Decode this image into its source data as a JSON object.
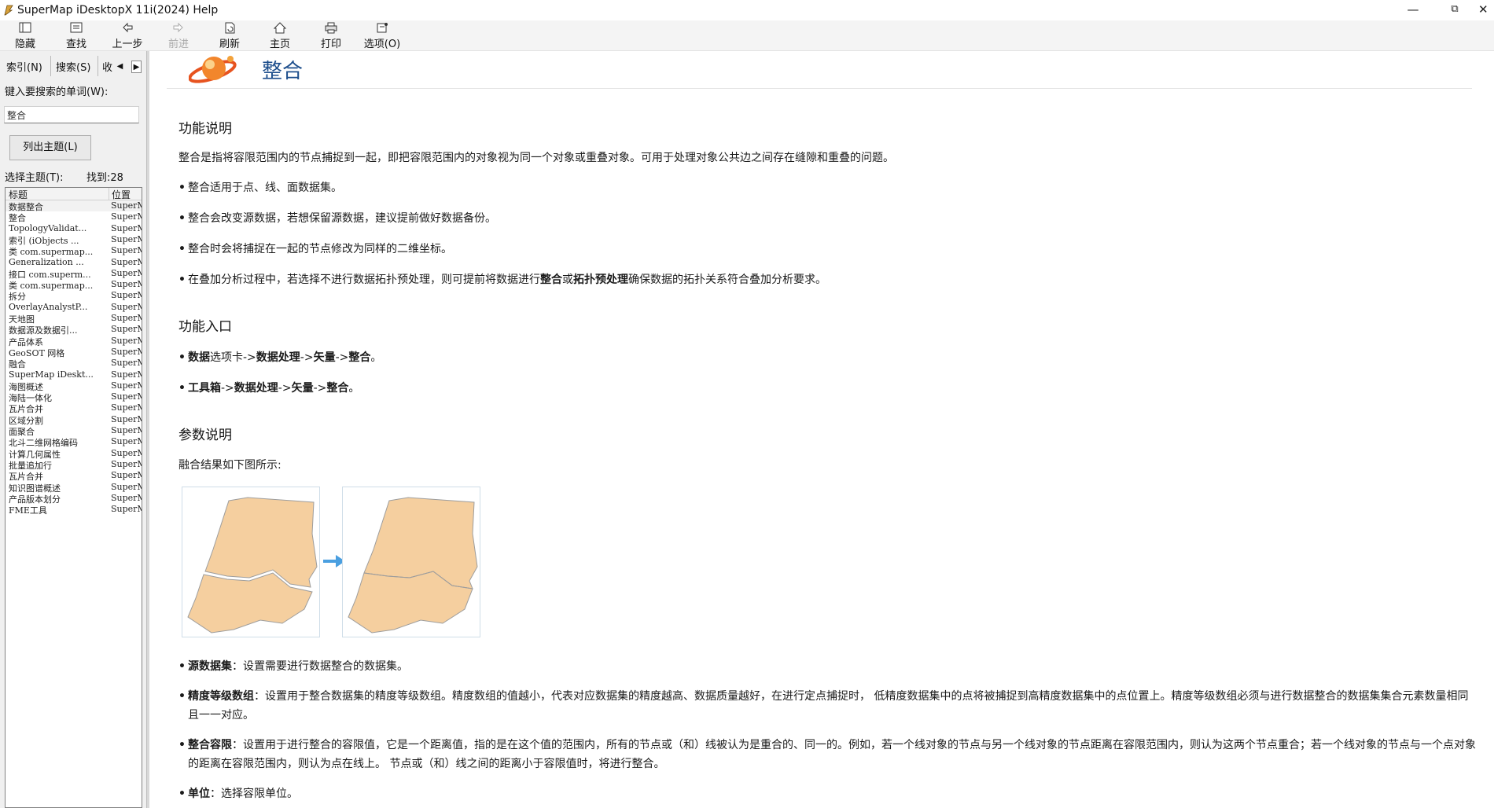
{
  "window": {
    "title": "SuperMap iDesktopX 11i(2024) Help",
    "controls": {
      "minimize": "—",
      "restore": "⧉",
      "close": "✕"
    }
  },
  "toolbar": {
    "items": [
      {
        "icon": "hide-icon",
        "label": "隐藏",
        "enabled": true
      },
      {
        "icon": "find-icon",
        "label": "查找",
        "enabled": true
      },
      {
        "icon": "back-icon",
        "label": "上一步",
        "enabled": true
      },
      {
        "icon": "forward-icon",
        "label": "前进",
        "enabled": false
      },
      {
        "icon": "refresh-icon",
        "label": "刷新",
        "enabled": true
      },
      {
        "icon": "home-icon",
        "label": "主页",
        "enabled": true
      },
      {
        "icon": "print-icon",
        "label": "打印",
        "enabled": true
      },
      {
        "icon": "options-icon",
        "label": "选项(O)",
        "enabled": true
      }
    ]
  },
  "sidebar": {
    "tabs": [
      {
        "label": "索引(N)",
        "active": false
      },
      {
        "label": "搜索(S)",
        "active": true
      },
      {
        "label": "收",
        "active": false
      }
    ],
    "search_label": "键入要搜索的单词(W):",
    "search_value": "整合",
    "list_button": "列出主题(L)",
    "select_label": "选择主题(T):",
    "found_label": "找到:28",
    "columns": [
      "标题",
      "位置"
    ],
    "results": [
      {
        "title": "数据整合",
        "location": "SuperMap"
      },
      {
        "title": "整合",
        "location": "SuperMap"
      },
      {
        "title": "TopologyValidat...",
        "location": "SuperMap"
      },
      {
        "title": "索引 (iObjects ...",
        "location": "SuperMap"
      },
      {
        "title": "类 com.supermap...",
        "location": "SuperMap"
      },
      {
        "title": "Generalization ...",
        "location": "SuperMap"
      },
      {
        "title": "接口 com.superm...",
        "location": "SuperMap"
      },
      {
        "title": "类 com.supermap...",
        "location": "SuperMap"
      },
      {
        "title": "拆分",
        "location": "SuperMap"
      },
      {
        "title": "OverlayAnalystP...",
        "location": "SuperMap"
      },
      {
        "title": "天地图",
        "location": "SuperMap"
      },
      {
        "title": "数据源及数据引...",
        "location": "SuperMap"
      },
      {
        "title": "产品体系",
        "location": "SuperMap"
      },
      {
        "title": "GeoSOT 网格",
        "location": "SuperMap"
      },
      {
        "title": "融合",
        "location": "SuperMap"
      },
      {
        "title": "SuperMap iDeskt...",
        "location": "SuperMap"
      },
      {
        "title": "海图概述",
        "location": "SuperMap"
      },
      {
        "title": "海陆一体化",
        "location": "SuperMap"
      },
      {
        "title": "瓦片合并",
        "location": "SuperMap"
      },
      {
        "title": "区域分割",
        "location": "SuperMap"
      },
      {
        "title": "面聚合",
        "location": "SuperMap"
      },
      {
        "title": "北斗二维网格编码",
        "location": "SuperMap"
      },
      {
        "title": "计算几何属性",
        "location": "SuperMap"
      },
      {
        "title": "批量追加行",
        "location": "SuperMap"
      },
      {
        "title": "瓦片合并",
        "location": "SuperMap"
      },
      {
        "title": "知识图谱概述",
        "location": "SuperMap"
      },
      {
        "title": "产品版本划分",
        "location": "SuperMap"
      },
      {
        "title": "FME工具",
        "location": "SuperMap"
      }
    ]
  },
  "content": {
    "page_title": "整合",
    "sections": {
      "function_title": "功能说明",
      "function_desc": "整合是指将容限范围内的节点捕捉到一起，即把容限范围内的对象视为同一个对象或重叠对象。可用于处理对象公共边之间存在缝隙和重叠的问题。",
      "function_bullets": [
        "整合适用于点、线、面数据集。",
        "整合会改变源数据，若想保留源数据，建议提前做好数据备份。",
        "整合时会将捕捉在一起的节点修改为同样的二维坐标。"
      ],
      "overlay_note": {
        "pre": "在叠加分析过程中，若选择不进行数据拓扑预处理，则可提前将数据进行",
        "b1": "整合",
        "mid": "或",
        "b2": "拓扑预处理",
        "post": "确保数据的拓扑关系符合叠加分析要求。"
      },
      "entry_title": "功能入口",
      "entry1": {
        "b1": "数据",
        "t1": "选项卡->",
        "b2": "数据处理",
        "t2": "->",
        "b3": "矢量",
        "t3": "->",
        "b4": "整合",
        "t4": "。"
      },
      "entry2": {
        "b1": "工具箱",
        "t1": "->",
        "b2": "数据处理",
        "t2": "->",
        "b3": "矢量",
        "t3": "->",
        "b4": "整合",
        "t4": "。"
      },
      "param_title": "参数说明",
      "figure_caption": "融合结果如下图所示:",
      "params": [
        {
          "name": "源数据集",
          "desc": "：设置需要进行数据整合的数据集。"
        },
        {
          "name": "精度等级数组",
          "desc": "：设置用于整合数据集的精度等级数组。精度数组的值越小，代表对应数据集的精度越高、数据质量越好，在进行定点捕捉时， 低精度数据集中的点将被捕捉到高精度数据集中的点位置上。精度等级数组必须与进行数据整合的数据集集合元素数量相同且一一对应。"
        },
        {
          "name": "整合容限",
          "desc": "：设置用于进行整合的容限值，它是一个距离值，指的是在这个值的范围内，所有的节点或（和）线被认为是重合的、同一的。例如，若一个线对象的节点与另一个线对象的节点距离在容限范围内，则认为这两个节点重合；若一个线对象的节点与一个点对象的距离在容限范围内，则认为点在线上。 节点或（和）线之间的距离小于容限值时，将进行整合。"
        },
        {
          "name": "单位",
          "desc": "：选择容限单位。"
        }
      ]
    }
  },
  "colors": {
    "polygon_fill": "#f5cf9f",
    "polygon_stroke": "#9d9d9d",
    "arrow": "#4a9fe0",
    "title_blue": "#1d4e8c"
  }
}
